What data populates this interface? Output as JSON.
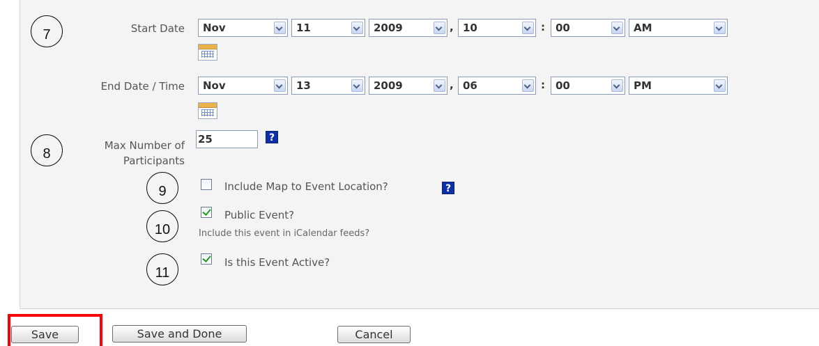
{
  "start_date": {
    "label": "Start Date",
    "month": "Nov",
    "day": "11",
    "year": "2009",
    "hour": "10",
    "minute": "00",
    "ampm": "AM",
    "date_sep": ",",
    "time_sep": ":"
  },
  "end_date": {
    "label": "End Date / Time",
    "month": "Nov",
    "day": "13",
    "year": "2009",
    "hour": "06",
    "minute": "00",
    "ampm": "PM",
    "date_sep": ",",
    "time_sep": ":"
  },
  "max_participants": {
    "label_line1": "Max Number of",
    "label_line2": "Participants",
    "value": "25",
    "help": "?"
  },
  "include_map": {
    "label": "Include Map to Event Location?",
    "checked": false,
    "help": "?"
  },
  "public_event": {
    "label": "Public Event?",
    "checked": true,
    "hint": "Include this event in iCalendar feeds?"
  },
  "event_active": {
    "label": "Is this Event Active?",
    "checked": true
  },
  "annotations": [
    "7",
    "8",
    "9",
    "10",
    "11"
  ],
  "buttons": {
    "save": "Save",
    "save_done": "Save and Done",
    "cancel": "Cancel"
  },
  "colors": {
    "highlight": "#ff0000",
    "help_bg": "#0d2fa8",
    "check": "#1f9a24"
  },
  "icons": {
    "calendar": "calendar-icon",
    "help": "help-icon"
  }
}
